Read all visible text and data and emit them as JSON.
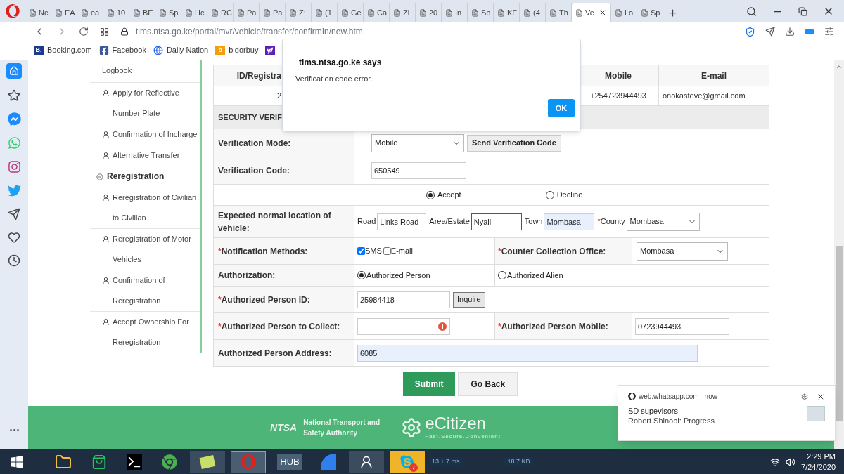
{
  "browser": {
    "tabs": [
      {
        "label": "Nc",
        "selected": false
      },
      {
        "label": "EA",
        "selected": false
      },
      {
        "label": "ea",
        "selected": false
      },
      {
        "label": "10",
        "selected": false
      },
      {
        "label": "BE",
        "selected": false
      },
      {
        "label": "Sp",
        "selected": false
      },
      {
        "label": "Hc",
        "selected": false
      },
      {
        "label": "RC",
        "selected": false
      },
      {
        "label": "Pa",
        "selected": false
      },
      {
        "label": "Pa",
        "selected": false
      },
      {
        "label": "Z:",
        "selected": false
      },
      {
        "label": "(1",
        "selected": false
      },
      {
        "label": "Ge",
        "selected": false
      },
      {
        "label": "Ca",
        "selected": false
      },
      {
        "label": "Zi",
        "selected": false
      },
      {
        "label": "20",
        "selected": false
      },
      {
        "label": "In",
        "selected": false
      },
      {
        "label": "Sp",
        "selected": false
      },
      {
        "label": "KF",
        "selected": false
      },
      {
        "label": "(4",
        "selected": false
      },
      {
        "label": "Th",
        "selected": false
      },
      {
        "label": "Ve",
        "selected": true
      },
      {
        "label": "Lo",
        "selected": false
      },
      {
        "label": "Sp",
        "selected": false
      }
    ],
    "url": "tims.ntsa.go.ke/portal/mvr/vehicle/transfer/confirmIn/new.htm",
    "bookmarks": [
      {
        "kind": "badge",
        "badge": "B.",
        "label": "Booking.com"
      },
      {
        "kind": "facebook",
        "label": "Facebook"
      },
      {
        "kind": "globe",
        "label": "Daily Nation"
      },
      {
        "kind": "badge",
        "badge": "b",
        "label": "bidorbuy"
      },
      {
        "kind": "yahoo"
      }
    ]
  },
  "nav": [
    {
      "kind": "continuation",
      "label": "Logbook"
    },
    {
      "kind": "link",
      "label": "Apply for Reflective Number Plate"
    },
    {
      "kind": "link",
      "label": "Confirmation of Incharge"
    },
    {
      "kind": "link",
      "label": "Alternative Transfer"
    },
    {
      "kind": "section",
      "label": "Reregistration"
    },
    {
      "kind": "link",
      "label": "Reregistration of Civilian to Civilian"
    },
    {
      "kind": "link",
      "label": "Reregistration of Motor Vehicles"
    },
    {
      "kind": "link",
      "label": "Confirmation of Reregistration"
    },
    {
      "kind": "link",
      "label": "Accept Ownership For Reregistration"
    }
  ],
  "owner_table": {
    "columns": [
      "ID/Registra",
      "Mobile",
      "E-mail"
    ],
    "row": [
      "2",
      "+254723944493",
      "onokasteve@gmail.com"
    ]
  },
  "security": {
    "heading": "SECURITY VERIF",
    "verification_mode": {
      "label": "Verification Mode:",
      "value": "Mobile",
      "button": "Send Verification Code"
    },
    "verification_code": {
      "label": "Verification Code:",
      "value": "650549"
    },
    "consent": [
      {
        "label": "Accept",
        "selected": true
      },
      {
        "label": "Decline",
        "selected": false
      }
    ]
  },
  "location": {
    "label": "Expected normal location of vehicle:",
    "fields": [
      {
        "kind": "text",
        "label": "Road",
        "value": "Links Road"
      },
      {
        "kind": "focused",
        "label": "Area/Estate",
        "value": "Nyali"
      },
      {
        "kind": "autofilled",
        "label": "Town",
        "value": "Mombasa"
      },
      {
        "kind": "select",
        "required_mark": "*",
        "label": "County",
        "value": "Mombasa"
      }
    ]
  },
  "notification": {
    "required_mark": "*",
    "label": "Notification Methods:",
    "options": [
      {
        "label": "SMS",
        "checked": true
      },
      {
        "label": "E-mail",
        "checked": false
      }
    ]
  },
  "counter_office": {
    "required_mark": "*",
    "label": "Counter Collection Office:",
    "value": "Mombasa"
  },
  "authorization": {
    "label": "Authorization:",
    "options": [
      {
        "label": "Authorized Person",
        "selected": true
      },
      {
        "label": "Authorized Alien",
        "selected": false
      }
    ]
  },
  "person_id": {
    "required_mark": "*",
    "label": "Authorized Person ID:",
    "value": "25984418",
    "button": "Inquire"
  },
  "person_collect": {
    "required_mark": "*",
    "label": "Authorized Person to Collect:",
    "error": true
  },
  "person_mobile": {
    "required_mark": "*",
    "label": "Authorized Person Mobile:",
    "value": "0723944493"
  },
  "person_address": {
    "label": "Authorized Person Address:",
    "value": "6085"
  },
  "actions": [
    {
      "kind": "primary",
      "label": "Submit"
    },
    {
      "kind": "secondary",
      "label": "Go Back"
    }
  ],
  "footer": {
    "ntsa_logo": "NTSA",
    "ntsa_name": "National Transport and Safety Authority",
    "ecitizen": "eCitizen",
    "ecitizen_tagline": "Fast.Secure.Convenient"
  },
  "dialog": {
    "title": "tims.ntsa.go.ke says",
    "message": "Verification code error.",
    "button": "OK"
  },
  "toast": {
    "source": "web.whatsapp.com",
    "time": "now",
    "title": "SD supevisors",
    "message": "Robert Shinobi: Progress"
  },
  "taskbar": {
    "hub_label": "HUB",
    "skype_badge": "7",
    "ping": "13 ± 7 ms",
    "traffic": "18.7 KB",
    "time": "2:29 PM",
    "date": "7/24/2020"
  }
}
